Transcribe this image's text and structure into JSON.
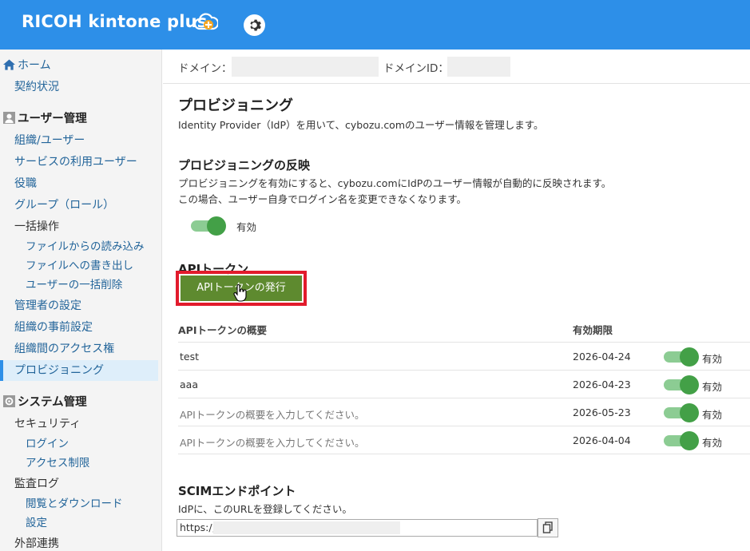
{
  "header": {
    "brand": "RICOH kintone plus"
  },
  "sidebar": {
    "home": "ホーム",
    "contract": "契約状況",
    "user_section": "ユーザー管理",
    "org_users": "組織/ユーザー",
    "service_users": "サービスの利用ユーザー",
    "roles": "役職",
    "groups": "グループ（ロール）",
    "bulk": "一括操作",
    "import": "ファイルからの読み込み",
    "export": "ファイルへの書き出し",
    "bulk_delete": "ユーザーの一括削除",
    "admin_settings": "管理者の設定",
    "org_pre": "組織の事前設定",
    "org_access": "組織間のアクセス権",
    "provisioning": "プロビジョニング",
    "system_section": "システム管理",
    "security": "セキュリティ",
    "login": "ログイン",
    "access_limit": "アクセス制限",
    "audit": "監査ログ",
    "view_download": "閲覧とダウンロード",
    "settings": "設定",
    "external": "外部連携"
  },
  "domain": {
    "domain_label": "ドメイン：",
    "domain_id_label": "ドメインID："
  },
  "page": {
    "title": "プロビジョニング",
    "desc": "Identity Provider（IdP）を用いて、cybozu.comのユーザー情報を管理します。",
    "reflect_title": "プロビジョニングの反映",
    "reflect_desc1": "プロビジョニングを有効にすると、cybozu.comにIdPのユーザー情報が自動的に反映されます。",
    "reflect_desc2": "この場合、ユーザー自身でログイン名を変更できなくなります。",
    "reflect_toggle_label": "有効",
    "api_title": "APIトークン",
    "issue_button": "APIトークンの発行"
  },
  "token_table": {
    "col_summary": "APIトークンの概要",
    "col_expiry": "有効期限",
    "rows": [
      {
        "summary": "test",
        "expiry": "2026-04-24",
        "status": "有効"
      },
      {
        "summary": "aaa",
        "expiry": "2026-04-23",
        "status": "有効"
      },
      {
        "summary": "APIトークンの概要を入力してください。",
        "expiry": "2026-05-23",
        "status": "有効"
      },
      {
        "summary": "APIトークンの概要を入力してください。",
        "expiry": "2026-04-04",
        "status": "有効"
      }
    ]
  },
  "scim": {
    "title": "SCIMエンドポイント",
    "desc": "IdPに、このURLを登録してください。",
    "url_prefix": "https:/,"
  },
  "colors": {
    "header": "#2d8fe8",
    "toggle_on": "#43a047",
    "issue_button": "#5e8a2f",
    "highlight": "#e21b2c"
  }
}
